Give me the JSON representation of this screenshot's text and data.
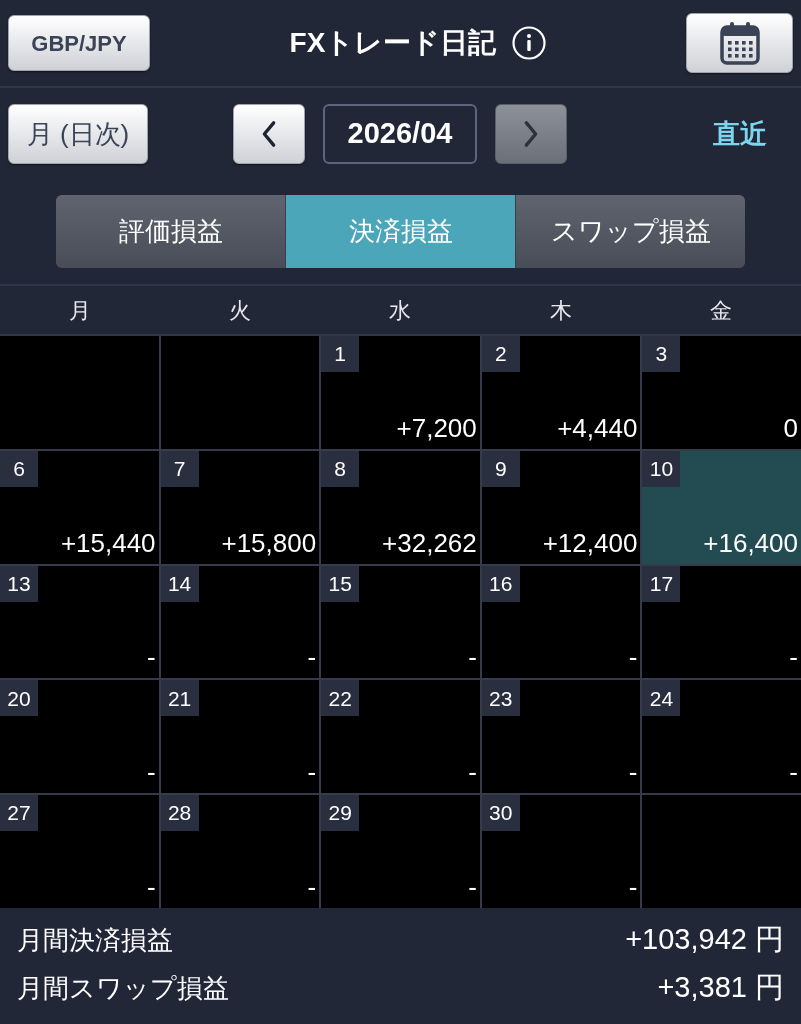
{
  "header": {
    "pair_button": "GBP/JPY",
    "title": "FXトレード日記"
  },
  "nav": {
    "mode_button": "月 (日次)",
    "prev": {
      "disabled": false
    },
    "month": "2026/04",
    "next": {
      "disabled": true
    },
    "latest_link": "直近"
  },
  "tabs": [
    {
      "label": "評価損益",
      "selected": false
    },
    {
      "label": "決済損益",
      "selected": true
    },
    {
      "label": "スワップ損益",
      "selected": false
    }
  ],
  "calendar": {
    "weekdays": [
      "月",
      "火",
      "水",
      "木",
      "金"
    ],
    "weeks": [
      {
        "cells": [
          {
            "kind": "blank"
          },
          {
            "kind": "blank"
          },
          {
            "kind": "day",
            "day": "1",
            "value": "+7,200",
            "selected": false
          },
          {
            "kind": "day",
            "day": "2",
            "value": "+4,440",
            "selected": false
          },
          {
            "kind": "day",
            "day": "3",
            "value": "0",
            "selected": false
          }
        ]
      },
      {
        "cells": [
          {
            "kind": "day",
            "day": "6",
            "value": "+15,440",
            "selected": false
          },
          {
            "kind": "day",
            "day": "7",
            "value": "+15,800",
            "selected": false
          },
          {
            "kind": "day",
            "day": "8",
            "value": "+32,262",
            "selected": false
          },
          {
            "kind": "day",
            "day": "9",
            "value": "+12,400",
            "selected": false
          },
          {
            "kind": "day",
            "day": "10",
            "value": "+16,400",
            "selected": true
          }
        ]
      },
      {
        "cells": [
          {
            "kind": "day",
            "day": "13",
            "value": "-",
            "selected": false
          },
          {
            "kind": "day",
            "day": "14",
            "value": "-",
            "selected": false
          },
          {
            "kind": "day",
            "day": "15",
            "value": "-",
            "selected": false
          },
          {
            "kind": "day",
            "day": "16",
            "value": "-",
            "selected": false
          },
          {
            "kind": "day",
            "day": "17",
            "value": "-",
            "selected": false
          }
        ]
      },
      {
        "cells": [
          {
            "kind": "day",
            "day": "20",
            "value": "-",
            "selected": false
          },
          {
            "kind": "day",
            "day": "21",
            "value": "-",
            "selected": false
          },
          {
            "kind": "day",
            "day": "22",
            "value": "-",
            "selected": false
          },
          {
            "kind": "day",
            "day": "23",
            "value": "-",
            "selected": false
          },
          {
            "kind": "day",
            "day": "24",
            "value": "-",
            "selected": false
          }
        ]
      },
      {
        "cells": [
          {
            "kind": "day",
            "day": "27",
            "value": "-",
            "selected": false
          },
          {
            "kind": "day",
            "day": "28",
            "value": "-",
            "selected": false
          },
          {
            "kind": "day",
            "day": "29",
            "value": "-",
            "selected": false
          },
          {
            "kind": "day",
            "day": "30",
            "value": "-",
            "selected": false
          },
          {
            "kind": "blank"
          }
        ]
      }
    ]
  },
  "summary": [
    {
      "label": "月間決済損益",
      "value": "+103,942 円"
    },
    {
      "label": "月間スワップ損益",
      "value": "+3,381 円"
    }
  ]
}
